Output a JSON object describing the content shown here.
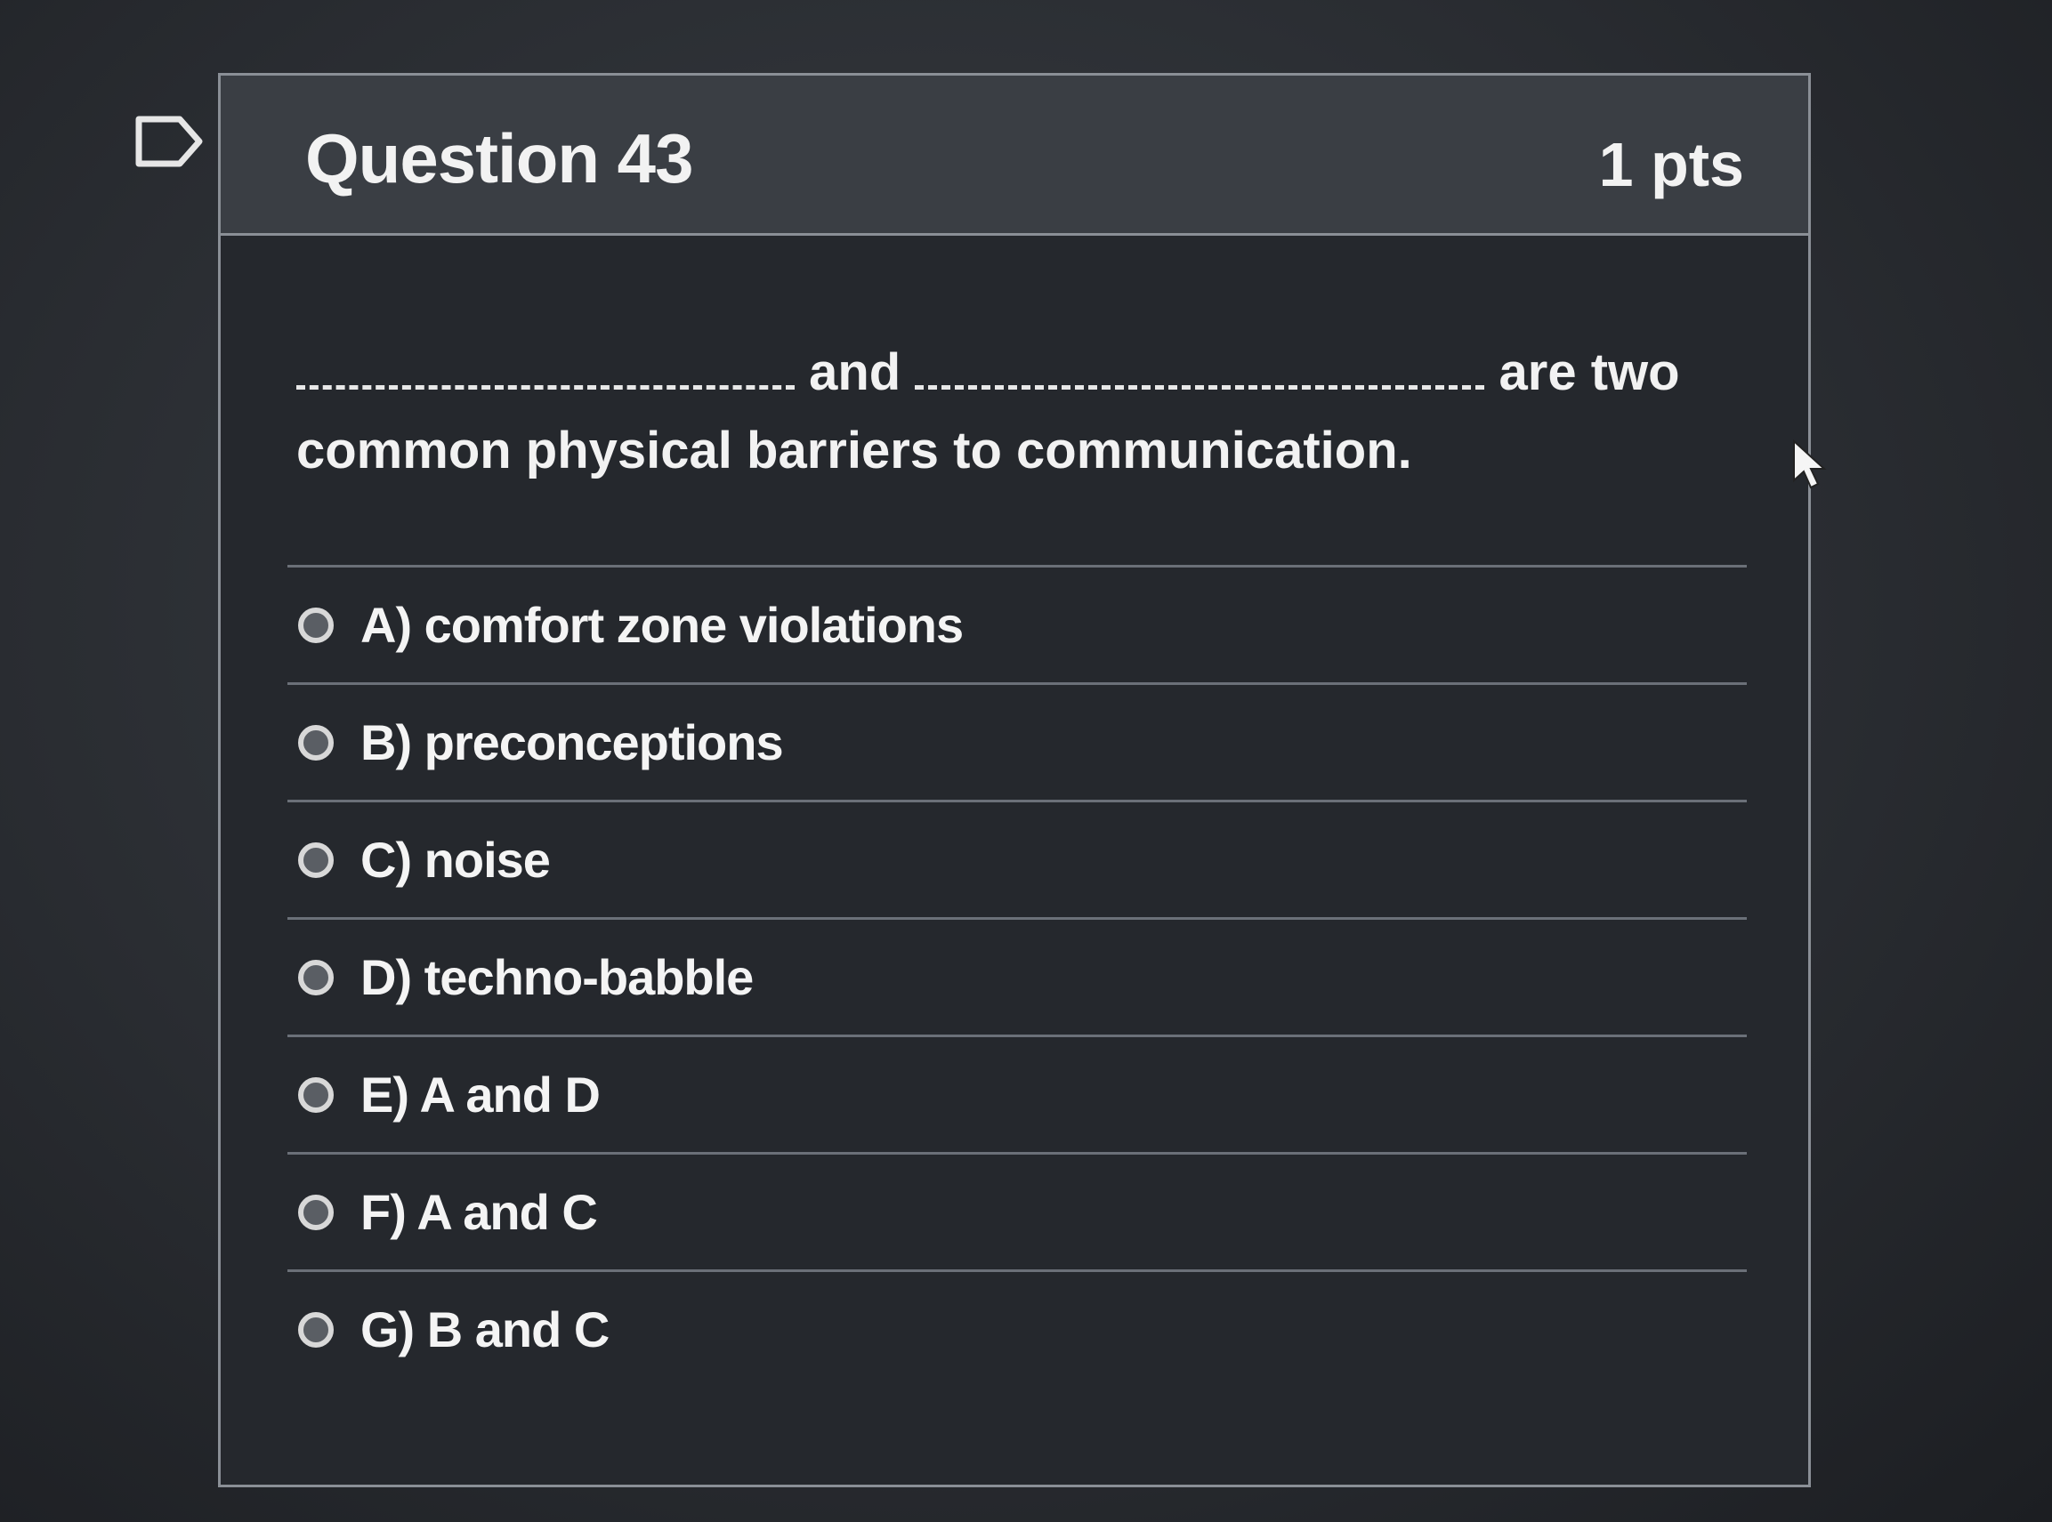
{
  "question": {
    "title": "Question 43",
    "points": "1 pts",
    "text_mid": "and",
    "text_end": "are two",
    "text_line2": "common physical barriers to communication."
  },
  "answers": [
    {
      "label": "A) comfort zone violations"
    },
    {
      "label": "B) preconceptions"
    },
    {
      "label": "C) noise"
    },
    {
      "label": "D) techno-babble"
    },
    {
      "label": "E) A and D"
    },
    {
      "label": "F) A and C"
    },
    {
      "label": "G) B and C"
    }
  ],
  "icons": {
    "flag": "flag-outline-icon",
    "cursor": "mouse-pointer-icon"
  },
  "colors": {
    "background": "#2b2e33",
    "header": "#3a3e44",
    "border": "#8a8f96",
    "text": "#f2f2f2"
  }
}
